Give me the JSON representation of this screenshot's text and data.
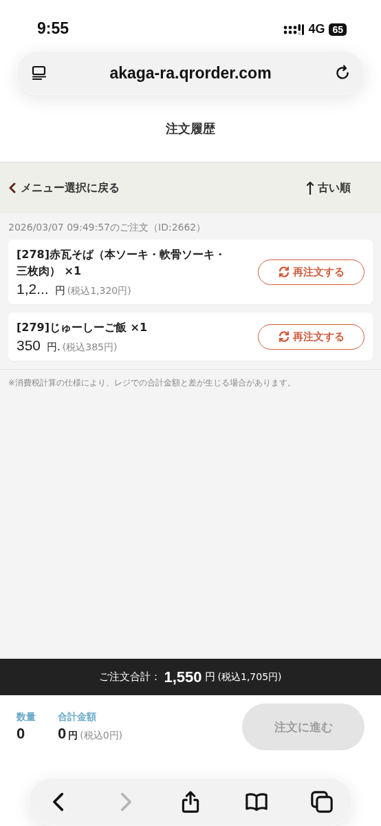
{
  "status_bar": {
    "time": "9:55",
    "network": "4G",
    "battery": "65"
  },
  "browser": {
    "url": "akaga-ra.qrorder.com"
  },
  "page_title": "注文履歴",
  "toolbar": {
    "back_link": "メニュー選択に戻る",
    "sort": "古い順"
  },
  "order": {
    "heading": "2026/03/07 09:49:57のご注文（ID:2662）",
    "items": [
      {
        "name": "[278]赤瓦そば（本ソーキ・軟骨ソーキ・三枚肉） ×1",
        "price": "1,2...",
        "unit": "円",
        "tax": "(税込1,320円)",
        "button": "再注文する"
      },
      {
        "name": "[279]じゅーしーご飯 ×1",
        "price": "350",
        "unit": "円.",
        "tax": "(税込385円)",
        "button": "再注文する"
      }
    ]
  },
  "note": "※消費税計算の仕様により、レジでの合計金額と差が生じる場合があります。",
  "order_total": {
    "label": "ご注文合計：",
    "amount": "1,550",
    "unit": "円",
    "tax": "(税込1,705円)"
  },
  "cart": {
    "quantity_label": "数量",
    "quantity": "0",
    "sum_label": "合計金額",
    "sum": "0",
    "sum_unit": "円",
    "sum_tax": "(税込0円)",
    "button": "注文に進む",
    "button_disabled": true
  },
  "browser_toolbar": [
    {
      "kind": "back",
      "disabled": false
    },
    {
      "kind": "forward",
      "disabled": true
    },
    {
      "kind": "share",
      "disabled": false
    },
    {
      "kind": "bookmarks",
      "disabled": false
    },
    {
      "kind": "tabs",
      "disabled": false
    }
  ]
}
